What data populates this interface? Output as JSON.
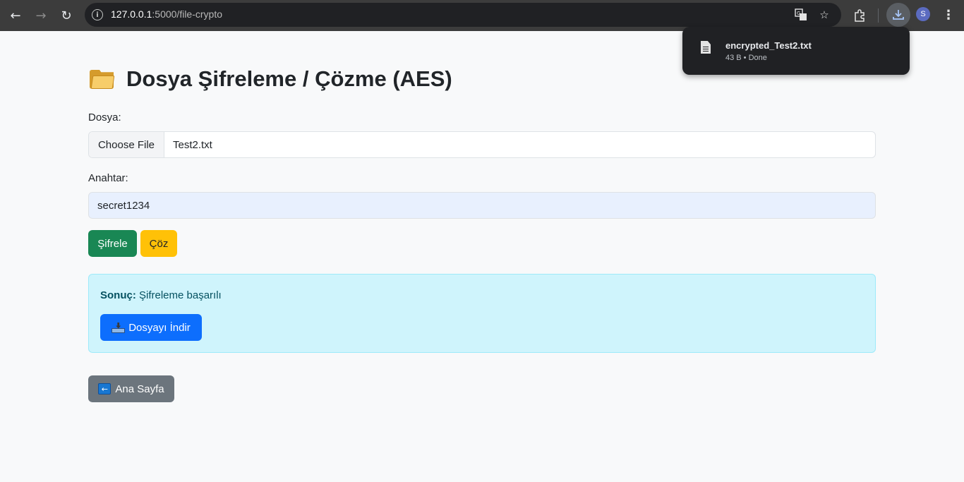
{
  "browser": {
    "url_host": "127.0.0.1",
    "url_path": ":5000/file-crypto",
    "avatar_letter": "S",
    "icons": {
      "back": "back-arrow-icon",
      "forward": "forward-arrow-icon",
      "reload": "reload-icon",
      "site_info": "info-icon",
      "translate": "translate-icon",
      "bookmark": "star-icon",
      "extensions": "puzzle-icon",
      "downloads": "download-icon",
      "menu": "kebab-menu-icon"
    }
  },
  "download_bubble": {
    "file_name": "encrypted_Test2.txt",
    "meta": "43 B • Done"
  },
  "page": {
    "title": "Dosya Şifreleme / Çözme (AES)",
    "file_label": "Dosya:",
    "choose_file": "Choose File",
    "file_name": "Test2.txt",
    "key_label": "Anahtar:",
    "key_value": "secret1234",
    "encrypt_button": "Şifrele",
    "decrypt_button": "Çöz",
    "result_label": "Sonuç:",
    "result_text": " Şifreleme başarılı",
    "download_button": "Dosyayı İndir",
    "home_button": "Ana Sayfa"
  },
  "colors": {
    "encrypt": "#198754",
    "decrypt": "#ffc107",
    "download": "#0d6efd",
    "home": "#6c757d",
    "alert_bg": "#cff4fc"
  }
}
